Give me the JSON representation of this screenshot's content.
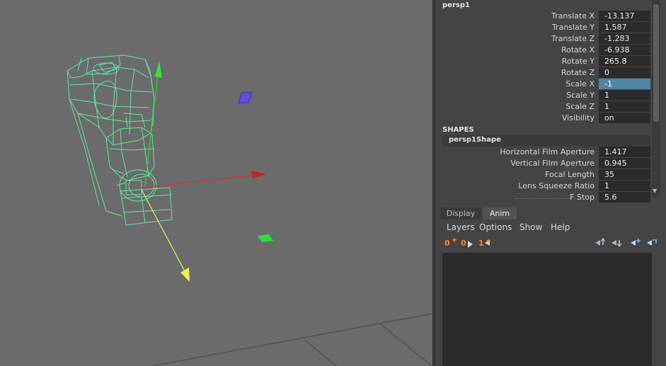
{
  "channel_box": {
    "object_name": "persp1",
    "transform_attributes": [
      {
        "label": "Translate X",
        "value": "-13.137",
        "selected": false
      },
      {
        "label": "Translate Y",
        "value": "1.587",
        "selected": false
      },
      {
        "label": "Translate Z",
        "value": "-1.283",
        "selected": false
      },
      {
        "label": "Rotate X",
        "value": "-6.938",
        "selected": false
      },
      {
        "label": "Rotate Y",
        "value": "265.8",
        "selected": false
      },
      {
        "label": "Rotate Z",
        "value": "0",
        "selected": false
      },
      {
        "label": "Scale X",
        "value": "-1",
        "selected": true
      },
      {
        "label": "Scale Y",
        "value": "1",
        "selected": false
      },
      {
        "label": "Scale Z",
        "value": "1",
        "selected": false
      },
      {
        "label": "Visibility",
        "value": "on",
        "selected": false
      }
    ],
    "shapes_header": "SHAPES",
    "shape_name": "persp1Shape",
    "shape_attributes": [
      {
        "label": "Horizontal Film Aperture",
        "value": "1.417"
      },
      {
        "label": "Vertical Film Aperture",
        "value": "0.945"
      },
      {
        "label": "Focal Length",
        "value": "35"
      },
      {
        "label": "Lens Squeeze Ratio",
        "value": "1"
      },
      {
        "label": "F Stop",
        "value": "5.6"
      }
    ]
  },
  "layer_editor": {
    "tabs": [
      {
        "label": "Display",
        "active": false
      },
      {
        "label": "Anim",
        "active": true
      }
    ],
    "menu": [
      "Layers",
      "Options",
      "Show",
      "Help"
    ],
    "layer_buttons": [
      "0",
      "0",
      "1"
    ],
    "accent_color": "#f08a2a",
    "selection_color": "#5285a6"
  },
  "viewport": {
    "background_color": "#6b6b6b",
    "wireframe_color": "#5fe79a",
    "manipulators": [
      "x-axis-red",
      "y-axis-green",
      "view-axis-yellow"
    ]
  }
}
